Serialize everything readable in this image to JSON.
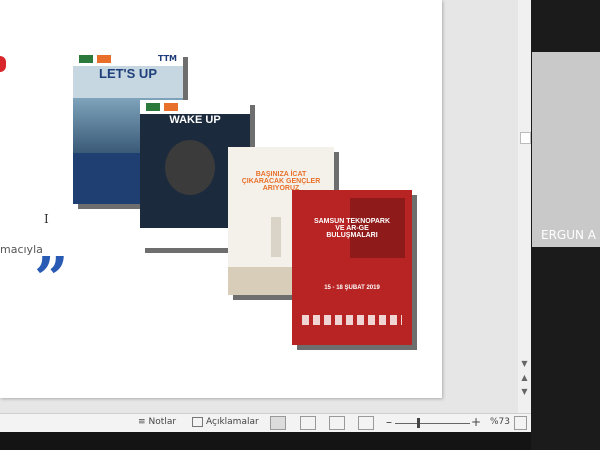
{
  "slide": {
    "left_fragment": "macıyla",
    "quote_mark": "”",
    "cursor_glyph": "I"
  },
  "posters": [
    {
      "title": "LET'S UP",
      "logo": "TTM"
    },
    {
      "title": "WAKE UP"
    },
    {
      "title": "BAŞINIZA İCAT ÇIKARACAK GENÇLER ARIYORUZ"
    },
    {
      "title": "SAMSUN TEKNOPARK VE AR-GE BULUŞMALARI",
      "date": "15 - 18 ŞUBAT 2019"
    }
  ],
  "webcam": {
    "name": "ERGUN A"
  },
  "statusbar": {
    "notes_label": "Notlar",
    "comments_label": "Açıklamalar",
    "zoom_minus": "–",
    "zoom_plus": "+",
    "zoom_level": "%73"
  },
  "colors": {
    "accent_red": "#d8262b",
    "quote_blue": "#2a5bb4",
    "poster_red": "#b82424"
  }
}
